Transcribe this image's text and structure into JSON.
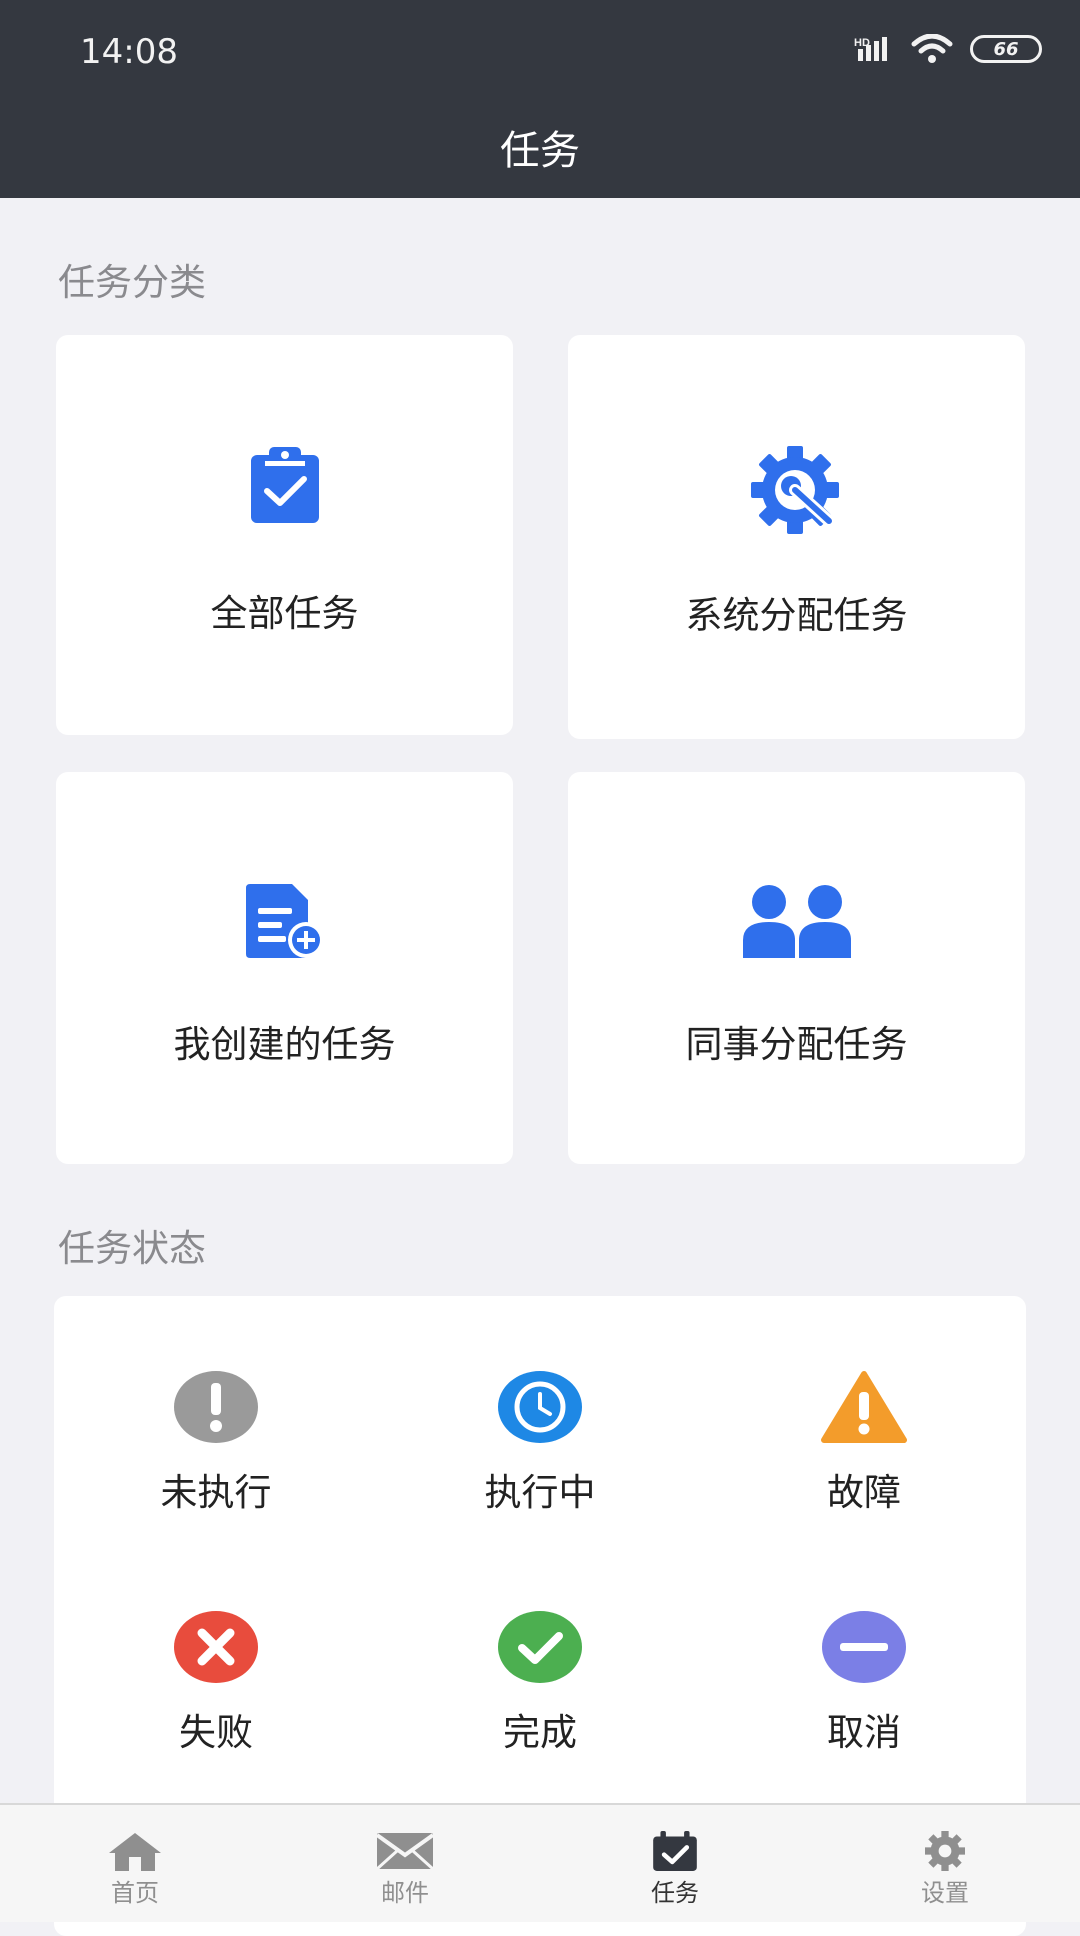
{
  "status_bar": {
    "time": "14:08",
    "battery": "66"
  },
  "header": {
    "title": "任务"
  },
  "categories": {
    "title": "任务分类",
    "items": [
      {
        "label": "全部任务",
        "icon": "clipboard-check-icon"
      },
      {
        "label": "系统分配任务",
        "icon": "gear-wrench-icon"
      },
      {
        "label": "我创建的任务",
        "icon": "document-add-icon"
      },
      {
        "label": "同事分配任务",
        "icon": "people-icon"
      }
    ]
  },
  "statuses": {
    "title": "任务状态",
    "items": [
      {
        "label": "未执行",
        "icon": "exclamation-icon",
        "color": "#9a9a9a"
      },
      {
        "label": "执行中",
        "icon": "clock-icon",
        "color": "#1e88e5"
      },
      {
        "label": "故障",
        "icon": "warning-icon",
        "color": "#f39c2b"
      },
      {
        "label": "失败",
        "icon": "x-icon",
        "color": "#e84c3d"
      },
      {
        "label": "完成",
        "icon": "check-icon",
        "color": "#4caf50"
      },
      {
        "label": "取消",
        "icon": "minus-icon",
        "color": "#7b7fe6"
      }
    ]
  },
  "tabbar": {
    "items": [
      {
        "label": "首页",
        "icon": "home-icon"
      },
      {
        "label": "邮件",
        "icon": "mail-icon"
      },
      {
        "label": "任务",
        "icon": "task-icon",
        "active": true
      },
      {
        "label": "设置",
        "icon": "settings-icon"
      }
    ]
  },
  "accent_color": "#2f6fec"
}
